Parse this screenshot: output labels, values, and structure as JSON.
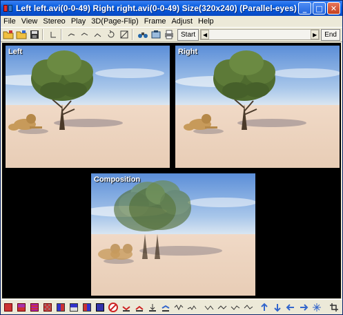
{
  "window": {
    "title": "Left left.avi(0-0-49) Right right.avi(0-0-49) Size(320x240)  (Parallel-eyes)",
    "minimize": "_",
    "maximize": "□",
    "close": "✕"
  },
  "menu": [
    "File",
    "View",
    "Stereo",
    "Play",
    "3D(Page-Flip)",
    "Frame",
    "Adjust",
    "Help"
  ],
  "toolbar": {
    "start_label": "Start",
    "end_label": "End",
    "slider_left_arrow": "◀",
    "slider_right_arrow": "▶"
  },
  "views": {
    "left_label": "Left",
    "right_label": "Right",
    "composition_label": "Composition"
  },
  "colors": {
    "title_gradient_top": "#3a81f3",
    "title_gradient_bottom": "#0a49c0",
    "chrome": "#ece9d8",
    "sky_top": "#5b8ed8",
    "sand": "#ecd3bd"
  }
}
